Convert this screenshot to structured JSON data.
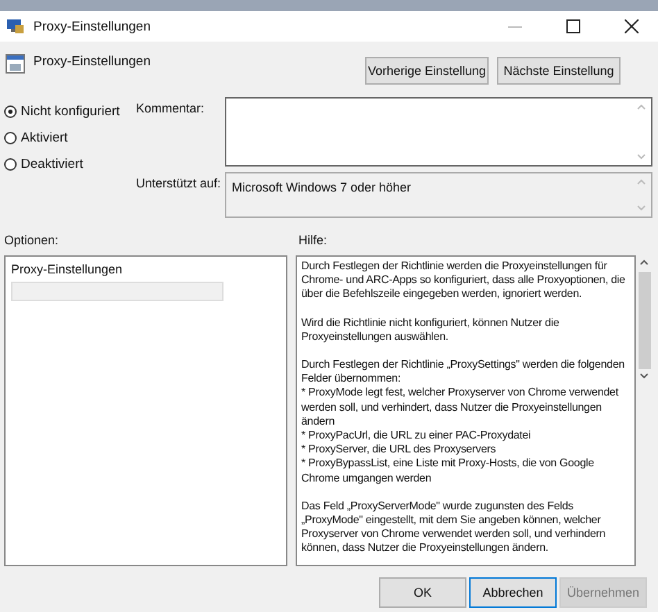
{
  "window": {
    "title": "Proxy-Einstellungen"
  },
  "header": {
    "policy_name": "Proxy-Einstellungen",
    "buttons": [
      {
        "label": "Vorherige Einstellung"
      },
      {
        "label": "Nächste Einstellung"
      }
    ]
  },
  "state_options": [
    {
      "label": "Nicht konfiguriert",
      "selected": true
    },
    {
      "label": "Aktiviert",
      "selected": false
    },
    {
      "label": "Deaktiviert",
      "selected": false
    }
  ],
  "comment": {
    "label": "Kommentar:"
  },
  "supported_on": {
    "label": "Unterstützt auf:",
    "value": "Microsoft Windows 7 oder höher"
  },
  "options": {
    "label": "Optionen:",
    "title": "Proxy-Einstellungen"
  },
  "help": {
    "label": "Hilfe:",
    "blocks": [
      {
        "lines": [
          "Durch Festlegen der Richtlinie werden die Proxyeinstellungen für Chrome- und ARC-Apps so konfiguriert, dass alle Proxyoptionen, die über die Befehlszeile eingegeben werden, ignoriert werden."
        ]
      },
      {
        "lines": [
          "Wird die Richtlinie nicht konfiguriert, können Nutzer die Proxyeinstellungen auswählen."
        ]
      },
      {
        "lines": [
          "Durch Festlegen der Richtlinie „ProxySettings\" werden die folgenden Felder übernommen:",
          "* ProxyMode legt fest, welcher Proxyserver von Chrome verwendet werden soll, und verhindert, dass Nutzer die Proxyeinstellungen ändern",
          "* ProxyPacUrl, die URL zu einer PAC-Proxydatei",
          "* ProxyServer, die URL des Proxyservers",
          "* ProxyBypassList, eine Liste mit Proxy-Hosts, die von Google Chrome umgangen werden"
        ]
      },
      {
        "lines": [
          "Das Feld „ProxyServerMode\" wurde zugunsten des Felds „ProxyMode\" eingestellt, mit dem Sie angeben können, welcher Proxyserver von Chrome verwendet werden soll, und verhindern können, dass Nutzer die Proxyeinstellungen ändern."
        ]
      }
    ]
  },
  "footer_buttons": [
    {
      "label": "OK",
      "focused": false,
      "disabled": false
    },
    {
      "label": "Abbrechen",
      "focused": true,
      "disabled": false
    },
    {
      "label": "Übernehmen",
      "focused": false,
      "disabled": true
    }
  ]
}
